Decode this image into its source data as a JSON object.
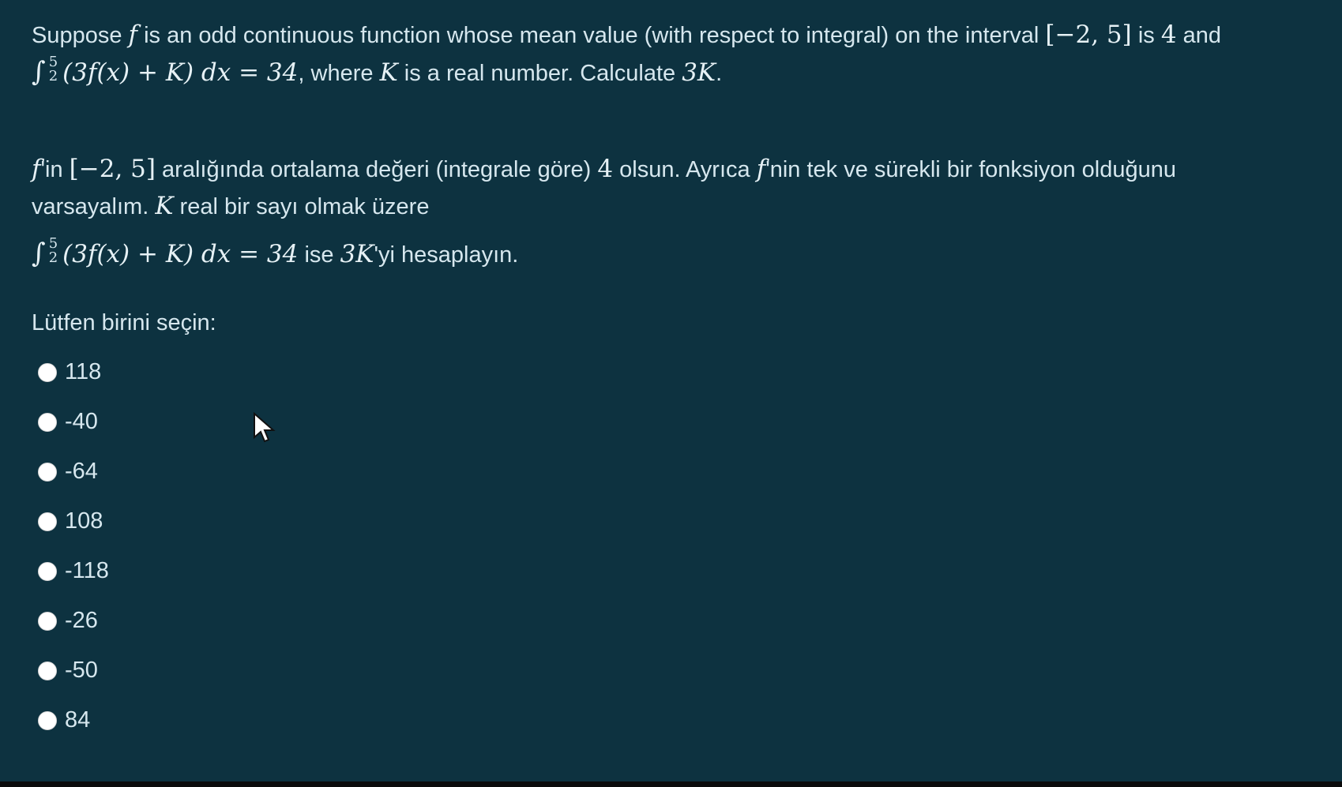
{
  "question": {
    "en": {
      "line1": {
        "t1": "Suppose ",
        "f": "f",
        "t2": " is an odd continuous function whose mean value (with respect to integral) on the interval ",
        "interval": "[−2, 5]",
        "t3": " is ",
        "mean": "4",
        "t4": " and"
      },
      "line2": {
        "sup": "5",
        "sub": "2",
        "integral": "∫",
        "expr": "(3f(x) + K) dx = 34",
        "t1": ", where ",
        "K": "K",
        "t2": " is a real number. Calculate ",
        "target": "3K",
        "t3": "."
      }
    },
    "tr": {
      "line1": {
        "f": "f",
        "t1": "'in ",
        "interval": "[−2, 5]",
        "t2": " aralığında ortalama değeri (integrale göre) ",
        "mean": "4",
        "t3": " olsun. Ayrıca ",
        "f2": "f",
        "t4": "'nin tek ve sürekli bir fonksiyon olduğunu"
      },
      "line2": {
        "t1": "varsayalım. ",
        "K": "K",
        "t2": " real bir sayı olmak üzere"
      },
      "line3": {
        "sup": "5",
        "sub": "2",
        "integral": "∫",
        "expr": "(3f(x) + K) dx = 34",
        "t1": " ise ",
        "target": "3K",
        "t2": "'yi hesaplayın."
      }
    }
  },
  "select_label": "Lütfen birini seçin:",
  "options": [
    {
      "label": "118"
    },
    {
      "label": "-40"
    },
    {
      "label": "-64"
    },
    {
      "label": "108"
    },
    {
      "label": "-118"
    },
    {
      "label": "-26"
    },
    {
      "label": "-50"
    },
    {
      "label": "84"
    }
  ],
  "colors": {
    "background": "#0d3240",
    "text": "#d6e7ee",
    "radio": "#ffffff"
  },
  "icons": {
    "cursor": "mouse-pointer-icon"
  }
}
